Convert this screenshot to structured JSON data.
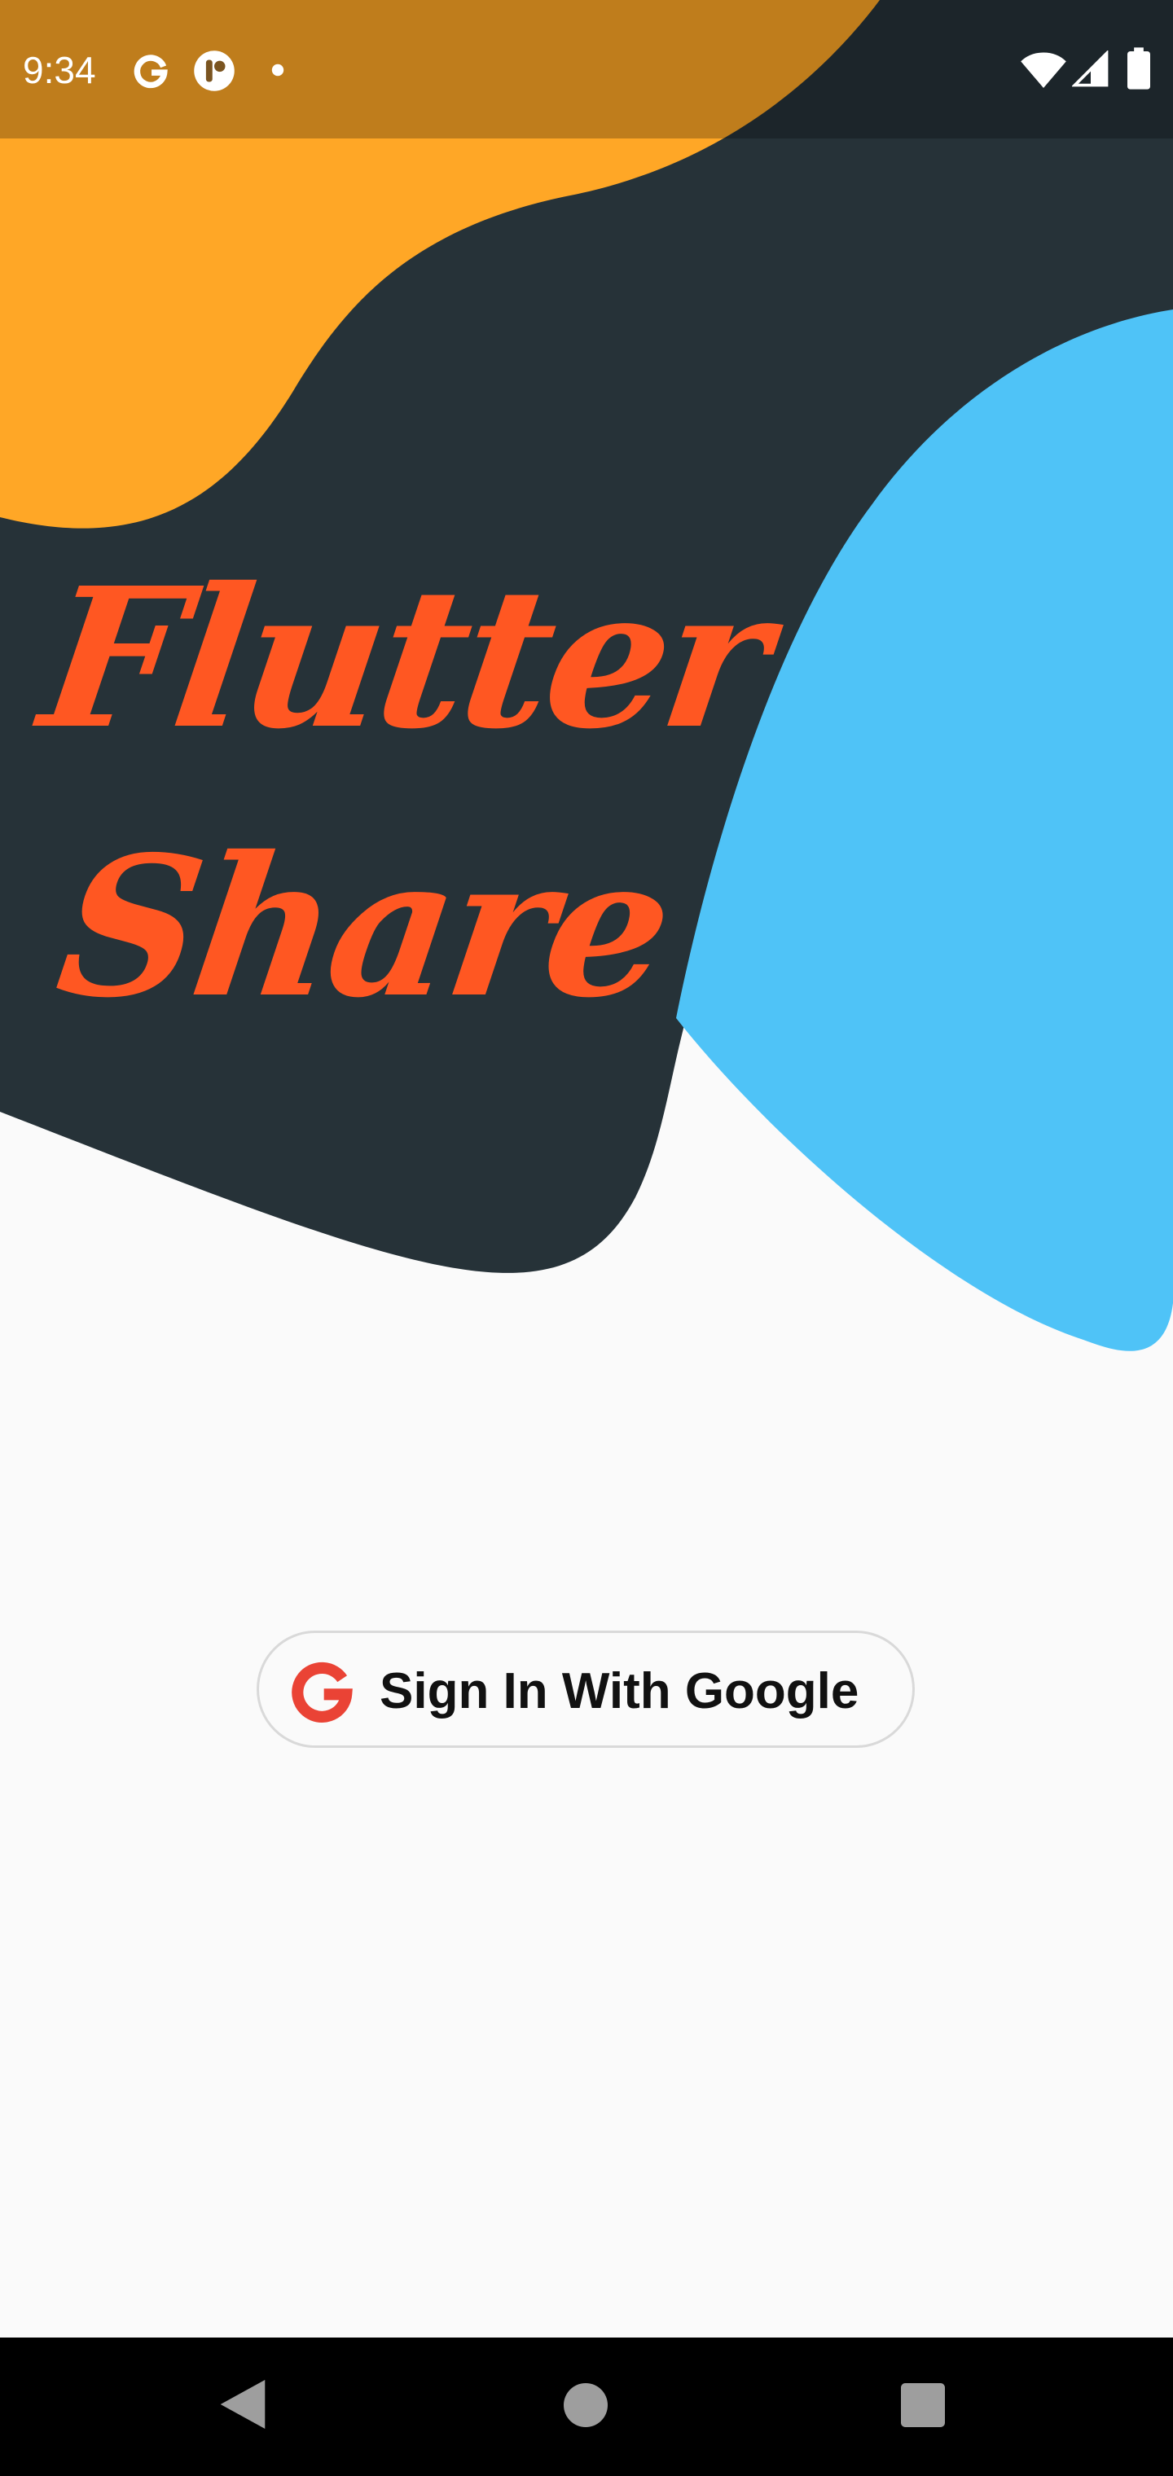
{
  "status_bar": {
    "time": "9:34",
    "left_icons": [
      "google-g-icon",
      "app-notification-icon",
      "dot-icon"
    ],
    "right_icons": [
      "wifi-icon",
      "cellular-signal-icon",
      "battery-icon"
    ]
  },
  "title": {
    "line1": "Flutter",
    "line2": "Share",
    "color": "#ff5722"
  },
  "signin": {
    "label": "Sign In With Google",
    "icon": "google-g-icon",
    "icon_color": "#ea4335"
  },
  "background": {
    "orange": "#ffa726",
    "dark": "#263238",
    "blue": "#4fc3f7",
    "light": "#fafafa"
  },
  "nav_bar": {
    "buttons": [
      "back-icon",
      "home-icon",
      "recents-icon"
    ]
  }
}
